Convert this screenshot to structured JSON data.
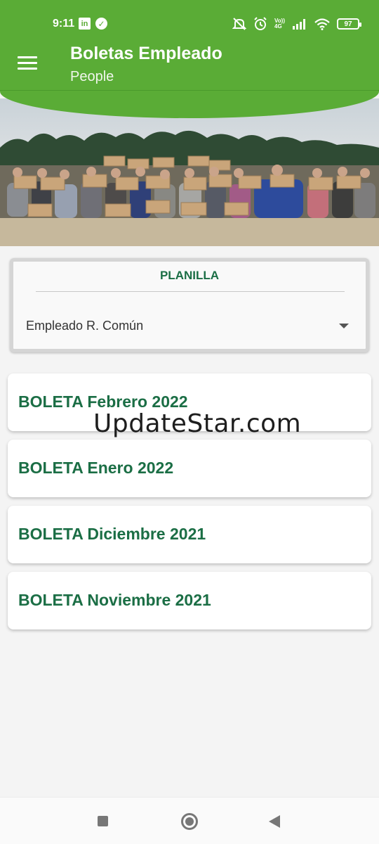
{
  "status_bar": {
    "time": "9:11",
    "linkedin_icon": "linkedin-icon",
    "check_icon": "check-circle-icon",
    "volte_label": "Vo)) 4G",
    "battery": "97",
    "icons": [
      "mute-icon",
      "alarm-icon",
      "volte-icon",
      "signal-icon",
      "wifi-icon",
      "battery-icon"
    ]
  },
  "header": {
    "title": "Boletas Empleado",
    "subtitle": "People",
    "menu_icon": "hamburger-menu-icon",
    "color": "#5aac36"
  },
  "hero": {
    "image_icon": "group-photo-image"
  },
  "planilla": {
    "title": "PLANILLA",
    "selected": "Empleado R. Común",
    "dropdown_icon": "dropdown-arrow-icon"
  },
  "boletas": [
    {
      "label": "BOLETA Febrero 2022"
    },
    {
      "label": "BOLETA Enero 2022"
    },
    {
      "label": "BOLETA Diciembre 2021"
    },
    {
      "label": "BOLETA Noviembre 2021"
    }
  ],
  "watermark": "UpdateStar.com",
  "accent_color": "#1b6e45",
  "nav": {
    "icons": [
      "recents-square-icon",
      "home-circle-icon",
      "back-triangle-icon"
    ]
  }
}
